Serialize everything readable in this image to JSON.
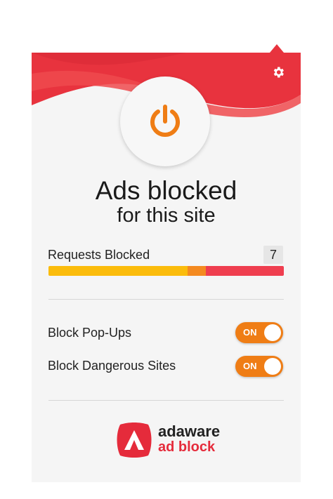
{
  "header": {
    "settings_icon": "gear-icon",
    "power_icon": "power-icon",
    "colors": {
      "header_red": "#e8333e",
      "accent_orange": "#ef7d15"
    }
  },
  "status": {
    "title": "Ads blocked",
    "subtitle": "for this site"
  },
  "requests": {
    "label": "Requests Blocked",
    "count": "7",
    "bar_segments": [
      {
        "color": "#fbbc0c",
        "fraction": 0.59
      },
      {
        "color": "#f48a20",
        "fraction": 0.08
      },
      {
        "color": "#ef3e4f",
        "fraction": 0.33
      }
    ]
  },
  "toggles": [
    {
      "label": "Block Pop-Ups",
      "state": "ON"
    },
    {
      "label": "Block Dangerous Sites",
      "state": "ON"
    }
  ],
  "logo": {
    "line1": "adaware",
    "line2": "ad block"
  }
}
